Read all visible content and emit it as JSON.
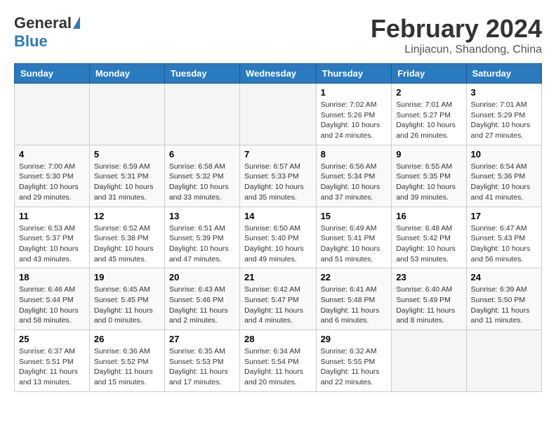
{
  "header": {
    "logo_general": "General",
    "logo_blue": "Blue",
    "month_title": "February 2024",
    "location": "Linjiacun, Shandong, China"
  },
  "days_of_week": [
    "Sunday",
    "Monday",
    "Tuesday",
    "Wednesday",
    "Thursday",
    "Friday",
    "Saturday"
  ],
  "weeks": [
    [
      {
        "day": "",
        "info": ""
      },
      {
        "day": "",
        "info": ""
      },
      {
        "day": "",
        "info": ""
      },
      {
        "day": "",
        "info": ""
      },
      {
        "day": "1",
        "info": "Sunrise: 7:02 AM\nSunset: 5:26 PM\nDaylight: 10 hours\nand 24 minutes."
      },
      {
        "day": "2",
        "info": "Sunrise: 7:01 AM\nSunset: 5:27 PM\nDaylight: 10 hours\nand 26 minutes."
      },
      {
        "day": "3",
        "info": "Sunrise: 7:01 AM\nSunset: 5:29 PM\nDaylight: 10 hours\nand 27 minutes."
      }
    ],
    [
      {
        "day": "4",
        "info": "Sunrise: 7:00 AM\nSunset: 5:30 PM\nDaylight: 10 hours\nand 29 minutes."
      },
      {
        "day": "5",
        "info": "Sunrise: 6:59 AM\nSunset: 5:31 PM\nDaylight: 10 hours\nand 31 minutes."
      },
      {
        "day": "6",
        "info": "Sunrise: 6:58 AM\nSunset: 5:32 PM\nDaylight: 10 hours\nand 33 minutes."
      },
      {
        "day": "7",
        "info": "Sunrise: 6:57 AM\nSunset: 5:33 PM\nDaylight: 10 hours\nand 35 minutes."
      },
      {
        "day": "8",
        "info": "Sunrise: 6:56 AM\nSunset: 5:34 PM\nDaylight: 10 hours\nand 37 minutes."
      },
      {
        "day": "9",
        "info": "Sunrise: 6:55 AM\nSunset: 5:35 PM\nDaylight: 10 hours\nand 39 minutes."
      },
      {
        "day": "10",
        "info": "Sunrise: 6:54 AM\nSunset: 5:36 PM\nDaylight: 10 hours\nand 41 minutes."
      }
    ],
    [
      {
        "day": "11",
        "info": "Sunrise: 6:53 AM\nSunset: 5:37 PM\nDaylight: 10 hours\nand 43 minutes."
      },
      {
        "day": "12",
        "info": "Sunrise: 6:52 AM\nSunset: 5:38 PM\nDaylight: 10 hours\nand 45 minutes."
      },
      {
        "day": "13",
        "info": "Sunrise: 6:51 AM\nSunset: 5:39 PM\nDaylight: 10 hours\nand 47 minutes."
      },
      {
        "day": "14",
        "info": "Sunrise: 6:50 AM\nSunset: 5:40 PM\nDaylight: 10 hours\nand 49 minutes."
      },
      {
        "day": "15",
        "info": "Sunrise: 6:49 AM\nSunset: 5:41 PM\nDaylight: 10 hours\nand 51 minutes."
      },
      {
        "day": "16",
        "info": "Sunrise: 6:48 AM\nSunset: 5:42 PM\nDaylight: 10 hours\nand 53 minutes."
      },
      {
        "day": "17",
        "info": "Sunrise: 6:47 AM\nSunset: 5:43 PM\nDaylight: 10 hours\nand 56 minutes."
      }
    ],
    [
      {
        "day": "18",
        "info": "Sunrise: 6:46 AM\nSunset: 5:44 PM\nDaylight: 10 hours\nand 58 minutes."
      },
      {
        "day": "19",
        "info": "Sunrise: 6:45 AM\nSunset: 5:45 PM\nDaylight: 11 hours\nand 0 minutes."
      },
      {
        "day": "20",
        "info": "Sunrise: 6:43 AM\nSunset: 5:46 PM\nDaylight: 11 hours\nand 2 minutes."
      },
      {
        "day": "21",
        "info": "Sunrise: 6:42 AM\nSunset: 5:47 PM\nDaylight: 11 hours\nand 4 minutes."
      },
      {
        "day": "22",
        "info": "Sunrise: 6:41 AM\nSunset: 5:48 PM\nDaylight: 11 hours\nand 6 minutes."
      },
      {
        "day": "23",
        "info": "Sunrise: 6:40 AM\nSunset: 5:49 PM\nDaylight: 11 hours\nand 8 minutes."
      },
      {
        "day": "24",
        "info": "Sunrise: 6:39 AM\nSunset: 5:50 PM\nDaylight: 11 hours\nand 11 minutes."
      }
    ],
    [
      {
        "day": "25",
        "info": "Sunrise: 6:37 AM\nSunset: 5:51 PM\nDaylight: 11 hours\nand 13 minutes."
      },
      {
        "day": "26",
        "info": "Sunrise: 6:36 AM\nSunset: 5:52 PM\nDaylight: 11 hours\nand 15 minutes."
      },
      {
        "day": "27",
        "info": "Sunrise: 6:35 AM\nSunset: 5:53 PM\nDaylight: 11 hours\nand 17 minutes."
      },
      {
        "day": "28",
        "info": "Sunrise: 6:34 AM\nSunset: 5:54 PM\nDaylight: 11 hours\nand 20 minutes."
      },
      {
        "day": "29",
        "info": "Sunrise: 6:32 AM\nSunset: 5:55 PM\nDaylight: 11 hours\nand 22 minutes."
      },
      {
        "day": "",
        "info": ""
      },
      {
        "day": "",
        "info": ""
      }
    ]
  ]
}
